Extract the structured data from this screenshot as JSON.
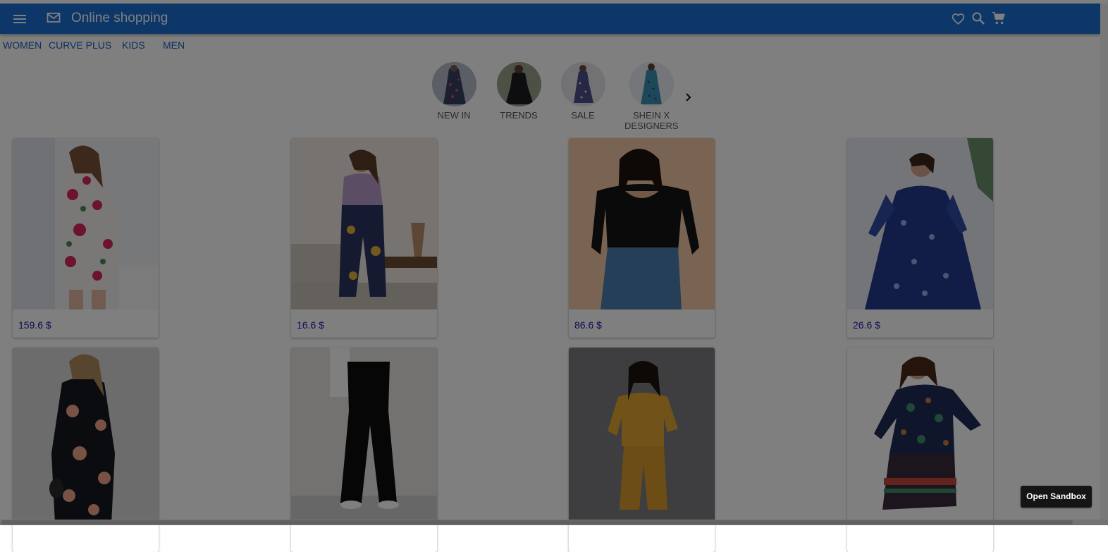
{
  "app": {
    "title": "Online shopping",
    "colors": {
      "appbar": "#1a6fd0",
      "price": "#1a1aa8",
      "category_link": "#1d5fb8"
    },
    "icons": [
      "menu-icon",
      "mail-icon",
      "heart-icon",
      "search-icon",
      "cart-icon"
    ]
  },
  "category_nav": [
    "WOMEN",
    "CURVE PLUS",
    "KIDS",
    "MEN"
  ],
  "collections": {
    "items": [
      "NEW IN",
      "TRENDS",
      "SALE",
      "SHEIN X DESIGNERS"
    ],
    "next_icon": "chevron-right-icon"
  },
  "products": [
    {
      "price": "159.6 $"
    },
    {
      "price": "16.6 $"
    },
    {
      "price": "86.6 $"
    },
    {
      "price": "26.6 $"
    },
    {
      "price": ""
    },
    {
      "price": ""
    },
    {
      "price": ""
    },
    {
      "price": ""
    }
  ],
  "sandbox_button": "Open Sandbox"
}
